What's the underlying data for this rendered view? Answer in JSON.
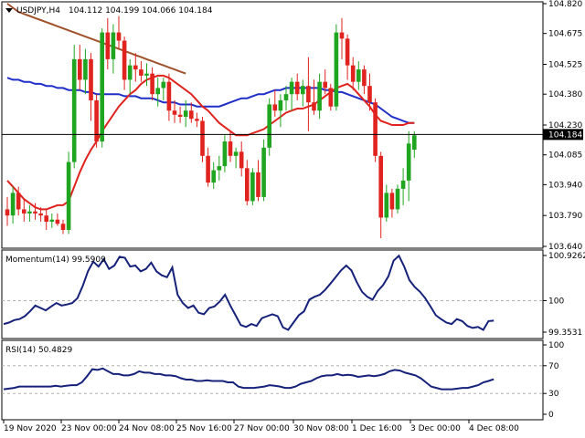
{
  "chart_data": {
    "type": "candlestick",
    "symbol_header": "USDJPY,H4",
    "ohlc_header": "104.112 104.199 104.066 104.184",
    "last_price": 104.184,
    "last_price_label": "104.184",
    "colors": {
      "bull": "#1fa51f",
      "bear": "#e0231e",
      "sma_fast": "#e0231e",
      "sma_mid": "#1f2fc8",
      "sma_slow": "#a0522d",
      "momentum": "#16217a",
      "rsi": "#16217a",
      "level_line": "#000000",
      "frame": "#000000",
      "dashed_level": "#b0b0b0"
    },
    "price_axis": {
      "ylim": [
        103.64,
        104.82
      ],
      "ticks": [
        104.82,
        104.675,
        104.525,
        104.38,
        104.23,
        104.085,
        103.94,
        103.79,
        103.64
      ],
      "tick_labels": [
        "104.820",
        "104.675",
        "104.525",
        "104.380",
        "104.230",
        "104.085",
        "103.940",
        "103.790",
        "103.640"
      ]
    },
    "x_axis": {
      "labels": [
        "19 Nov 2020",
        "23 Nov 00:00",
        "24 Nov 08:00",
        "25 Nov 16:00",
        "27 Nov 00:00",
        "30 Nov 08:00",
        "1 Dec 16:00",
        "3 Dec 00:00",
        "4 Dec 08:00"
      ],
      "label_bar_index": [
        0,
        11,
        23,
        35,
        47,
        59,
        71,
        83,
        95
      ]
    },
    "candles": [
      [
        103.82,
        103.88,
        103.74,
        103.79
      ],
      [
        103.79,
        103.93,
        103.75,
        103.9
      ],
      [
        103.9,
        103.93,
        103.79,
        103.82
      ],
      [
        103.82,
        103.87,
        103.76,
        103.8
      ],
      [
        103.8,
        103.84,
        103.76,
        103.81
      ],
      [
        103.81,
        103.85,
        103.77,
        103.8
      ],
      [
        103.8,
        103.83,
        103.76,
        103.79
      ],
      [
        103.79,
        103.82,
        103.72,
        103.76
      ],
      [
        103.76,
        103.8,
        103.73,
        103.77
      ],
      [
        103.77,
        103.8,
        103.74,
        103.75
      ],
      [
        103.75,
        103.77,
        103.7,
        103.72
      ],
      [
        103.72,
        104.1,
        103.7,
        104.05
      ],
      [
        104.05,
        104.62,
        104.02,
        104.55
      ],
      [
        104.55,
        104.62,
        104.4,
        104.45
      ],
      [
        104.45,
        104.6,
        104.38,
        104.55
      ],
      [
        104.55,
        104.58,
        104.25,
        104.35
      ],
      [
        104.35,
        104.38,
        104.12,
        104.15
      ],
      [
        104.15,
        104.7,
        104.12,
        104.68
      ],
      [
        104.68,
        104.75,
        104.5,
        104.55
      ],
      [
        104.55,
        104.72,
        104.48,
        104.68
      ],
      [
        104.68,
        104.76,
        104.6,
        104.64
      ],
      [
        104.64,
        104.66,
        104.4,
        104.45
      ],
      [
        104.45,
        104.55,
        104.38,
        104.52
      ],
      [
        104.52,
        104.58,
        104.44,
        104.5
      ],
      [
        104.5,
        104.54,
        104.44,
        104.47
      ],
      [
        104.47,
        104.53,
        104.42,
        104.48
      ],
      [
        104.48,
        104.51,
        104.35,
        104.38
      ],
      [
        104.38,
        104.46,
        104.32,
        104.41
      ],
      [
        104.41,
        104.46,
        104.35,
        104.44
      ],
      [
        104.44,
        104.48,
        104.25,
        104.3
      ],
      [
        104.3,
        104.35,
        104.24,
        104.28
      ],
      [
        104.28,
        104.32,
        104.24,
        104.27
      ],
      [
        104.27,
        104.35,
        104.22,
        104.3
      ],
      [
        104.3,
        104.34,
        104.24,
        104.26
      ],
      [
        104.26,
        104.29,
        104.22,
        104.25
      ],
      [
        104.25,
        104.27,
        104.05,
        104.08
      ],
      [
        104.08,
        104.12,
        103.93,
        103.95
      ],
      [
        103.95,
        104.05,
        103.92,
        104.01
      ],
      [
        104.01,
        104.08,
        103.96,
        104.03
      ],
      [
        104.03,
        104.18,
        104.0,
        104.15
      ],
      [
        104.15,
        104.2,
        104.05,
        104.08
      ],
      [
        104.08,
        104.12,
        104.02,
        104.1
      ],
      [
        104.1,
        104.15,
        103.98,
        104.02
      ],
      [
        104.02,
        104.06,
        103.84,
        103.86
      ],
      [
        103.86,
        104.02,
        103.84,
        104.0
      ],
      [
        104.0,
        104.06,
        103.86,
        103.88
      ],
      [
        103.88,
        104.16,
        103.86,
        104.12
      ],
      [
        104.12,
        104.36,
        104.08,
        104.33
      ],
      [
        104.33,
        104.4,
        104.27,
        104.3
      ],
      [
        104.3,
        104.38,
        104.22,
        104.35
      ],
      [
        104.35,
        104.42,
        104.3,
        104.38
      ],
      [
        104.38,
        104.46,
        104.3,
        104.44
      ],
      [
        104.44,
        104.48,
        104.35,
        104.38
      ],
      [
        104.38,
        104.45,
        104.32,
        104.42
      ],
      [
        104.42,
        104.56,
        104.2,
        104.34
      ],
      [
        104.34,
        104.45,
        104.28,
        104.3
      ],
      [
        104.3,
        104.48,
        104.26,
        104.44
      ],
      [
        104.44,
        104.5,
        104.38,
        104.41
      ],
      [
        104.41,
        104.43,
        104.3,
        104.32
      ],
      [
        104.32,
        104.72,
        104.3,
        104.68
      ],
      [
        104.68,
        104.75,
        104.55,
        104.65
      ],
      [
        104.65,
        104.67,
        104.45,
        104.52
      ],
      [
        104.52,
        104.56,
        104.4,
        104.44
      ],
      [
        104.44,
        104.54,
        104.4,
        104.5
      ],
      [
        104.5,
        104.52,
        104.38,
        104.42
      ],
      [
        104.42,
        104.48,
        104.3,
        104.34
      ],
      [
        104.34,
        104.36,
        104.05,
        104.08
      ],
      [
        104.08,
        104.1,
        103.68,
        103.78
      ],
      [
        103.78,
        103.94,
        103.76,
        103.9
      ],
      [
        103.9,
        103.92,
        103.78,
        103.82
      ],
      [
        103.82,
        103.94,
        103.8,
        103.92
      ],
      [
        103.92,
        104.02,
        103.84,
        103.96
      ],
      [
        103.96,
        104.2,
        103.86,
        104.14
      ],
      [
        104.11,
        104.2,
        104.07,
        104.18
      ]
    ],
    "sma_fast": [
      103.96,
      103.93,
      103.9,
      103.87,
      103.85,
      103.83,
      103.82,
      103.82,
      103.83,
      103.84,
      103.84,
      103.86,
      103.93,
      104.0,
      104.06,
      104.11,
      104.15,
      104.2,
      104.24,
      104.28,
      104.32,
      104.35,
      104.38,
      104.4,
      104.43,
      104.45,
      104.46,
      104.47,
      104.47,
      104.46,
      104.44,
      104.42,
      104.4,
      104.38,
      104.35,
      104.32,
      104.3,
      104.27,
      104.24,
      104.22,
      104.2,
      104.18,
      104.18,
      104.18,
      104.19,
      104.2,
      104.21,
      104.23,
      104.25,
      104.27,
      104.29,
      104.3,
      104.31,
      104.31,
      104.32,
      104.33,
      104.35,
      104.37,
      104.39,
      104.41,
      104.42,
      104.43,
      104.41,
      104.38,
      104.35,
      104.32,
      104.28,
      104.25,
      104.24,
      104.23,
      104.23,
      104.23,
      104.24,
      104.24
    ],
    "sma_mid": [
      104.46,
      104.45,
      104.45,
      104.44,
      104.44,
      104.43,
      104.43,
      104.42,
      104.42,
      104.41,
      104.41,
      104.4,
      104.4,
      104.4,
      104.39,
      104.39,
      104.38,
      104.38,
      104.38,
      104.38,
      104.38,
      104.37,
      104.37,
      104.37,
      104.36,
      104.36,
      104.36,
      104.35,
      104.34,
      104.34,
      104.34,
      104.33,
      104.33,
      104.33,
      104.32,
      104.32,
      104.32,
      104.32,
      104.32,
      104.33,
      104.34,
      104.35,
      104.36,
      104.36,
      104.37,
      104.38,
      104.38,
      104.39,
      104.4,
      104.4,
      104.41,
      104.41,
      104.41,
      104.41,
      104.41,
      104.41,
      104.41,
      104.4,
      104.4,
      104.39,
      104.39,
      104.38,
      104.37,
      104.36,
      104.35,
      104.34,
      104.33,
      104.31,
      104.29,
      104.27,
      104.26,
      104.25,
      104.24,
      104.24
    ],
    "sma_slow": [
      104.82,
      104.8,
      104.78,
      104.77,
      104.76,
      104.75,
      104.74,
      104.73,
      104.72,
      104.71,
      104.7,
      104.69,
      104.68,
      104.67,
      104.66,
      104.65,
      104.64,
      104.63,
      104.62,
      104.61,
      104.6,
      104.59,
      104.58,
      104.57,
      104.56,
      104.55,
      104.54,
      104.53,
      104.52,
      104.51,
      104.5,
      104.49,
      104.48
    ],
    "momentum": {
      "label": "Momentum(14) 99.5909",
      "ylim": [
        99.3531,
        100.9262
      ],
      "ticks": [
        100.9262,
        100,
        99.3531
      ],
      "tick_labels": [
        "100.9262",
        "100",
        "99.3531"
      ],
      "level": 100,
      "values": [
        99.52,
        99.55,
        99.6,
        99.62,
        99.68,
        99.78,
        99.9,
        99.85,
        99.8,
        99.88,
        99.95,
        99.9,
        99.92,
        99.95,
        100.05,
        100.3,
        100.6,
        100.8,
        100.7,
        100.85,
        100.65,
        100.72,
        100.9,
        100.88,
        100.7,
        100.72,
        100.6,
        100.65,
        100.78,
        100.6,
        100.52,
        100.48,
        100.68,
        100.12,
        99.95,
        99.85,
        99.9,
        99.75,
        99.72,
        99.85,
        99.88,
        99.98,
        100.12,
        99.9,
        99.7,
        99.5,
        99.46,
        99.52,
        99.48,
        99.64,
        99.68,
        99.72,
        99.68,
        99.45,
        99.4,
        99.55,
        99.7,
        99.78,
        100.02,
        100.08,
        100.12,
        100.22,
        100.35,
        100.48,
        100.62,
        100.72,
        100.62,
        100.38,
        100.18,
        100.08,
        100.02,
        100.2,
        100.32,
        100.5,
        100.82,
        100.92,
        100.7,
        100.42,
        100.28,
        100.18,
        100.05,
        99.88,
        99.7,
        99.62,
        99.55,
        99.52,
        99.62,
        99.58,
        99.48,
        99.44,
        99.46,
        99.4,
        99.58,
        99.59
      ]
    },
    "rsi": {
      "label": "RSI(14) 50.4829",
      "ylim": [
        0,
        100
      ],
      "ticks": [
        100,
        70,
        30,
        0
      ],
      "tick_labels": [
        "100",
        "70",
        "30",
        "0"
      ],
      "levels": [
        70,
        30
      ],
      "values": [
        36,
        37,
        38,
        40,
        40,
        40,
        40,
        40,
        40,
        40,
        41,
        40,
        41,
        42,
        42,
        46,
        55,
        65,
        64,
        66,
        62,
        58,
        58,
        56,
        56,
        58,
        62,
        60,
        60,
        58,
        58,
        56,
        56,
        55,
        52,
        50,
        50,
        48,
        48,
        49,
        48,
        48,
        48,
        46,
        46,
        40,
        38,
        38,
        38,
        39,
        40,
        42,
        41,
        40,
        38,
        38,
        40,
        44,
        46,
        48,
        52,
        55,
        56,
        56,
        58,
        56,
        57,
        56,
        54,
        55,
        56,
        55,
        56,
        58,
        62,
        64,
        63,
        60,
        58,
        56,
        52,
        46,
        40,
        38,
        36,
        36,
        36,
        37,
        38,
        38,
        40,
        42,
        46,
        48,
        50.48
      ]
    }
  }
}
